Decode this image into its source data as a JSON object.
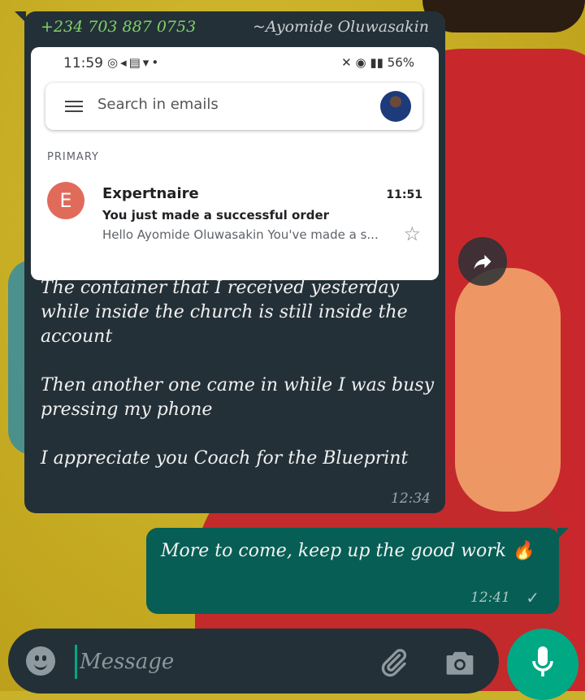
{
  "incoming": {
    "sender_phone": "+234 703 887 0753",
    "sender_name": "~Ayomide Oluwasakin",
    "screenshot": {
      "status_time": "11:59",
      "status_icons_left": "◎◂▤▾•",
      "battery": "56%",
      "search_placeholder": "Search in emails",
      "section": "PRIMARY",
      "email": {
        "avatar_letter": "E",
        "from": "Expertnaire",
        "time": "11:51",
        "subject": "You just made a successful order",
        "preview": "Hello Ayomide Oluwasakin You've made a s..."
      }
    },
    "paragraphs": [
      "The container that I received yesterday while inside the church is still inside the account",
      "Then another one came in while I was busy pressing my phone",
      "I appreciate you Coach for the Blueprint"
    ],
    "time": "12:34"
  },
  "outgoing": {
    "text": "More to come, keep up the good work 🔥",
    "time": "12:41",
    "status": "✓"
  },
  "composer": {
    "placeholder": "Message"
  },
  "colors": {
    "incoming_bg": "#243038",
    "outgoing_bg": "#075e54",
    "accent": "#00a884",
    "sender_phone": "#7fd16a"
  }
}
